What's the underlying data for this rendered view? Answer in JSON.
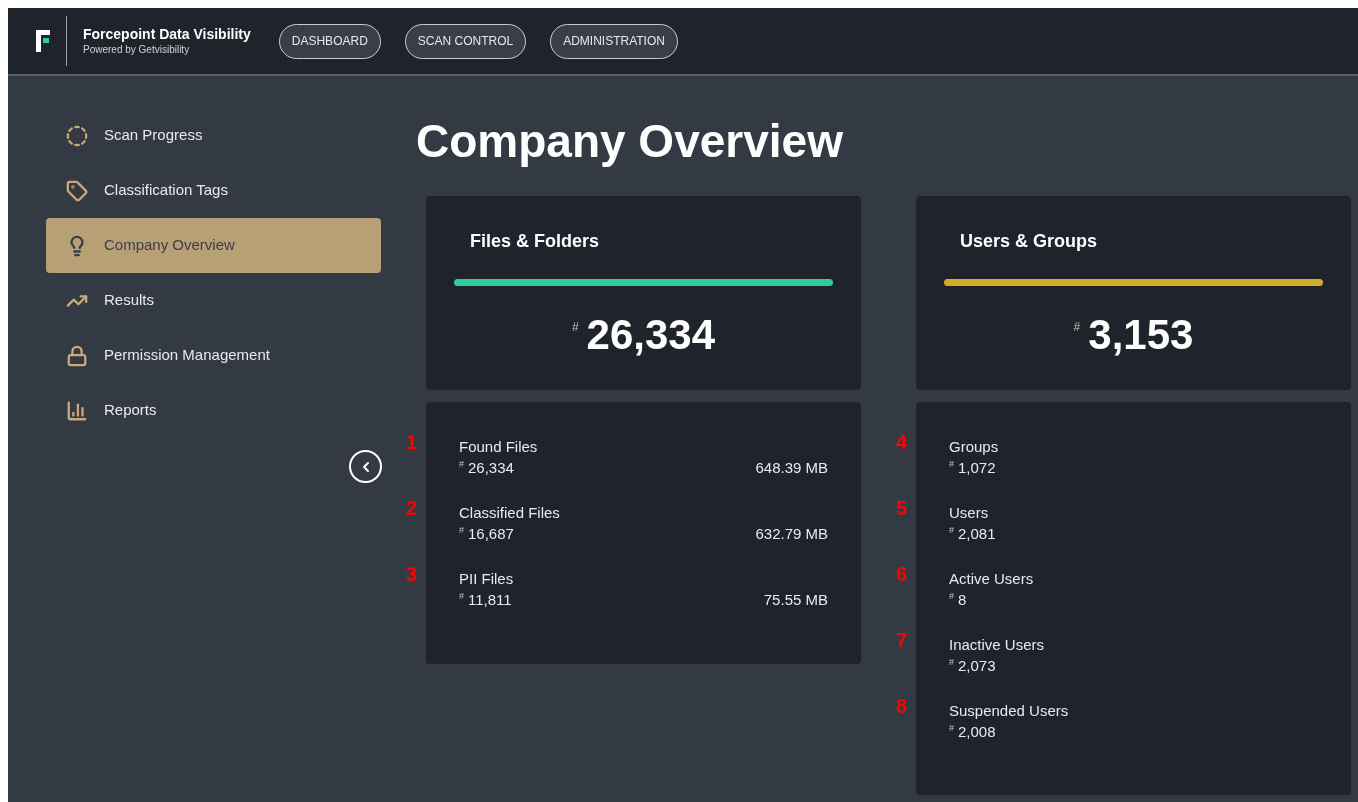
{
  "header": {
    "brand": "Forcepoint Data Visibility",
    "tagline": "Powered by Getvisibility",
    "nav": [
      {
        "label": "DASHBOARD",
        "selected": false
      },
      {
        "label": "SCAN CONTROL",
        "selected": false
      },
      {
        "label": "ADMINISTRATION",
        "selected": false
      }
    ]
  },
  "sidebar": {
    "items": [
      {
        "kind": "progress",
        "label": "Scan Progress",
        "selected": false
      },
      {
        "kind": "tag",
        "label": "Classification Tags",
        "selected": false
      },
      {
        "kind": "bulb",
        "label": "Company Overview",
        "selected": true
      },
      {
        "kind": "trend",
        "label": "Results",
        "selected": false
      },
      {
        "kind": "lock",
        "label": "Permission Management",
        "selected": false
      },
      {
        "kind": "report",
        "label": "Reports",
        "selected": false
      }
    ]
  },
  "page_title": "Company Overview",
  "panels": [
    {
      "title": "Files & Folders",
      "color": "#2fcc9c",
      "prefix": "#",
      "total": "26,334",
      "stats": [
        {
          "annotation": "1",
          "label": "Found Files",
          "prefix": "#",
          "value": "26,334",
          "size": "648.39 MB"
        },
        {
          "annotation": "2",
          "label": "Classified Files",
          "prefix": "#",
          "value": "16,687",
          "size": "632.79 MB"
        },
        {
          "annotation": "3",
          "label": "PII Files",
          "prefix": "#",
          "value": "11,811",
          "size": "75.55 MB"
        }
      ]
    },
    {
      "title": "Users & Groups",
      "color": "#d4aa2a",
      "prefix": "#",
      "total": "3,153",
      "stats": [
        {
          "annotation": "4",
          "label": "Groups",
          "prefix": "#",
          "value": "1,072"
        },
        {
          "annotation": "5",
          "label": "Users",
          "prefix": "#",
          "value": "2,081"
        },
        {
          "annotation": "6",
          "label": "Active Users",
          "prefix": "#",
          "value": "8"
        },
        {
          "annotation": "7",
          "label": "Inactive Users",
          "prefix": "#",
          "value": "2,073"
        },
        {
          "annotation": "8",
          "label": "Suspended Users",
          "prefix": "#",
          "value": "2,008"
        }
      ]
    }
  ]
}
